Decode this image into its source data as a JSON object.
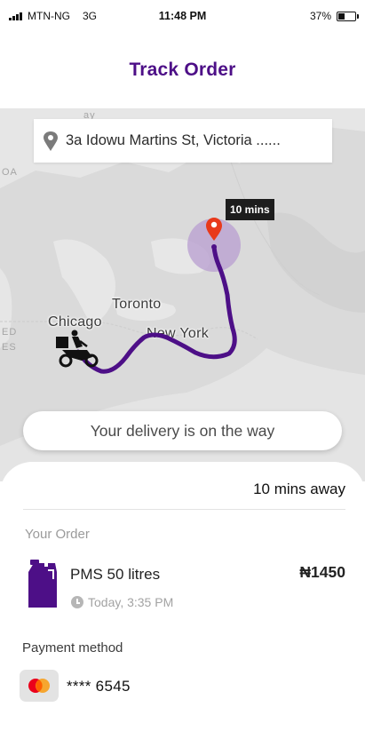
{
  "status_bar": {
    "carrier": "MTN-NG",
    "network": "3G",
    "time": "11:48 PM",
    "battery": "37%",
    "battery_level": 0.37
  },
  "header": {
    "title": "Track Order"
  },
  "map": {
    "address": "3a Idowu Martins St, Victoria ......",
    "eta_tag": "10 mins",
    "labels": {
      "chicago": "Chicago",
      "toronto": "Toronto",
      "new_york": "New York"
    },
    "faint_labels": {
      "top": "ay",
      "left_top": "OA",
      "left_mid": "ED",
      "left_low": "ES"
    },
    "delivery_status": "Your delivery is on the way",
    "colors": {
      "route": "#4d0f87",
      "pin": "#e8391b",
      "radius": "#b89dd0"
    }
  },
  "sheet": {
    "eta_away": "10 mins away",
    "your_order_label": "Your Order",
    "product_name": "PMS 50 litres",
    "product_price": "₦1450",
    "order_time": "Today, 3:35 PM",
    "payment_label": "Payment method",
    "card_number": "**** 6545"
  },
  "icons": {
    "location_pin": "location-pin-icon",
    "courier": "delivery-rider-icon",
    "fuel_can": "fuel-can-icon",
    "clock": "clock-icon",
    "card_brand": "mastercard-icon"
  },
  "colors": {
    "brand": "#4d0f87",
    "fuel_can": "#4d0f87"
  }
}
